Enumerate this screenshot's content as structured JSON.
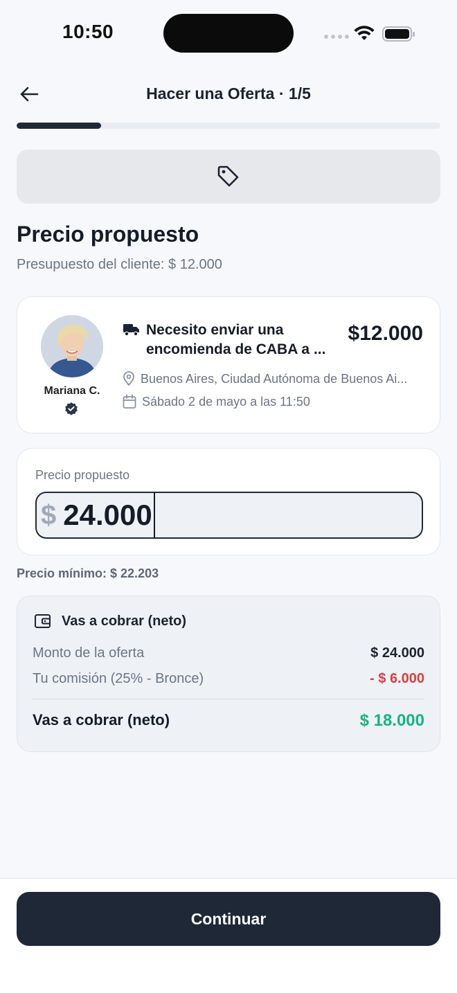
{
  "status_bar": {
    "time": "10:50"
  },
  "header": {
    "title": "Hacer una Oferta · 1/5",
    "step_progress": 0.2
  },
  "section": {
    "title": "Precio propuesto",
    "subtitle": "Presupuesto del cliente: $ 12.000"
  },
  "request": {
    "user_name": "Mariana C.",
    "title": "Necesito enviar una encomienda de CABA a ...",
    "price": "$12.000",
    "location": "Buenos Aires, Ciudad Autónoma de Buenos Ai...",
    "date": "Sábado 2 de mayo a las 11:50"
  },
  "offer": {
    "label": "Precio propuesto",
    "currency": "$",
    "amount": "24.000"
  },
  "min_price": "Precio mínimo: $ 22.203",
  "net": {
    "heading": "Vas a cobrar (neto)",
    "offer_label": "Monto de la oferta",
    "offer_value": "$ 24.000",
    "commission_label": "Tu comisión (25% - Bronce)",
    "commission_value": "- $ 6.000",
    "total_label": "Vas a cobrar (neto)",
    "total_value": "$ 18.000"
  },
  "cta": {
    "label": "Continuar"
  },
  "colors": {
    "primary": "#1f2837",
    "positive": "#19b47e",
    "negative": "#e03d3d"
  },
  "icons": [
    "back-arrow-icon",
    "tag-icon",
    "truck-icon",
    "location-pin-icon",
    "calendar-icon",
    "verified-icon",
    "wallet-icon"
  ]
}
